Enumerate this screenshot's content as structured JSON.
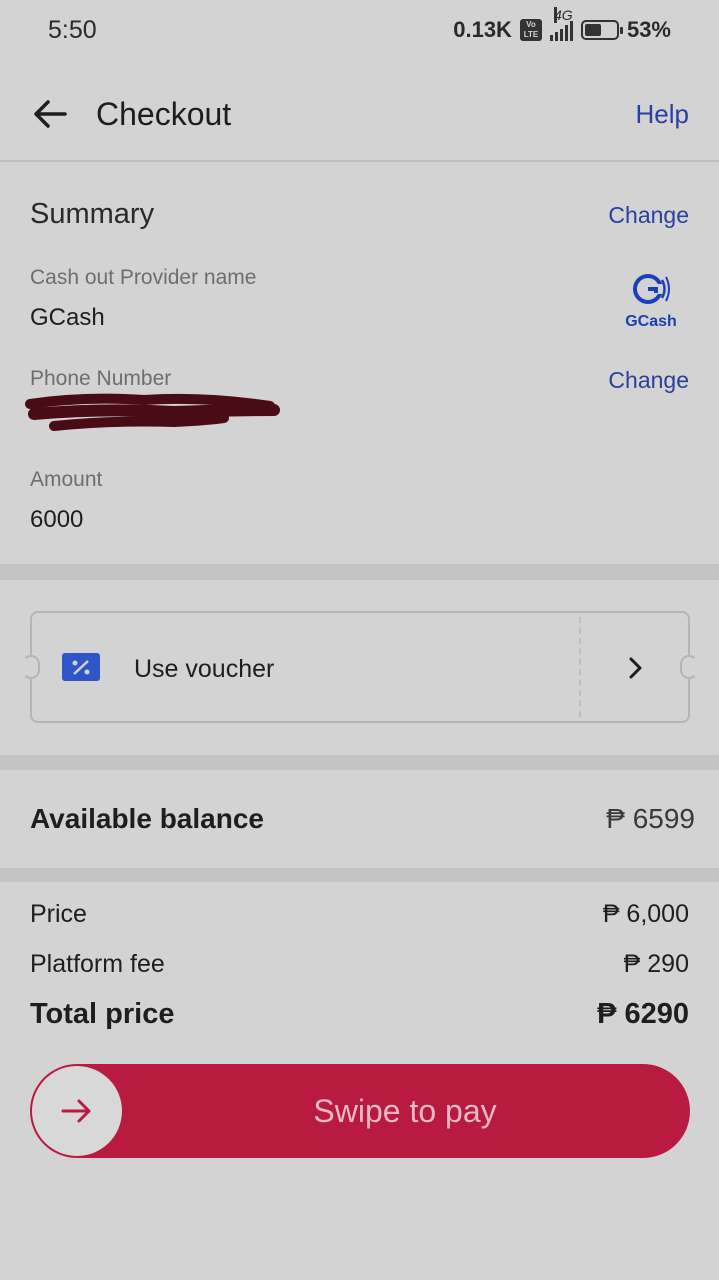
{
  "status_bar": {
    "time": "5:50",
    "data_rate": "0.13K",
    "volte": "Vo LTE",
    "network": "4G",
    "battery": "53%",
    "battery_level": 0.53
  },
  "header": {
    "title": "Checkout",
    "help_label": "Help"
  },
  "summary": {
    "title": "Summary",
    "change_label": "Change",
    "provider_label": "Cash out Provider name",
    "provider_value": "GCash",
    "provider_logo_text": "GCash",
    "phone_label": "Phone Number",
    "phone_change_label": "Change",
    "amount_label": "Amount",
    "amount_value": "6000"
  },
  "voucher": {
    "label": "Use voucher"
  },
  "balance": {
    "label": "Available balance",
    "value": "₱ 6599"
  },
  "pricing": {
    "rows": [
      {
        "label": "Price",
        "value": "₱ 6,000"
      },
      {
        "label": "Platform fee",
        "value": "₱ 290"
      }
    ],
    "total_label": "Total price",
    "total_value": "₱ 6290"
  },
  "swipe": {
    "label": "Swipe to pay"
  },
  "colors": {
    "accent_link": "#2a3f9e",
    "pay_button": "#b81a40",
    "background": "#d3d3d3"
  }
}
